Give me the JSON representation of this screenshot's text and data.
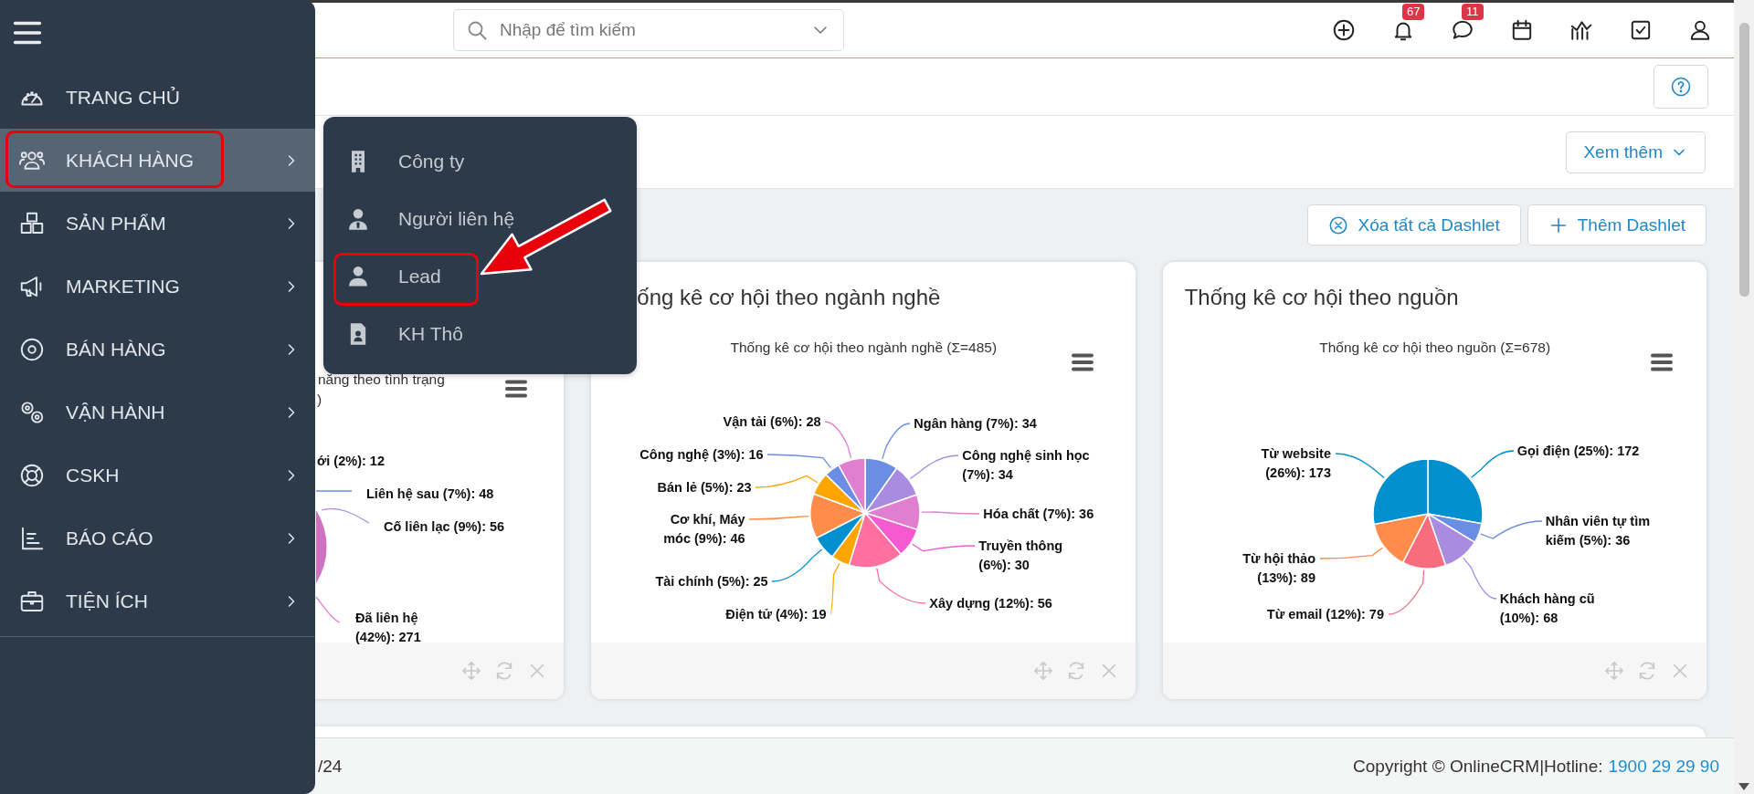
{
  "sidebar": {
    "items": [
      {
        "label": "TRANG CHỦ",
        "selected": false,
        "has_submenu": false
      },
      {
        "label": "KHÁCH HÀNG",
        "selected": true,
        "has_submenu": true
      },
      {
        "label": "SẢN PHẨM",
        "selected": false,
        "has_submenu": true
      },
      {
        "label": "MARKETING",
        "selected": false,
        "has_submenu": true
      },
      {
        "label": "BÁN HÀNG",
        "selected": false,
        "has_submenu": true
      },
      {
        "label": "VẬN HÀNH",
        "selected": false,
        "has_submenu": true
      },
      {
        "label": "CSKH",
        "selected": false,
        "has_submenu": true
      },
      {
        "label": "BÁO CÁO",
        "selected": false,
        "has_submenu": true
      },
      {
        "label": "TIỆN ÍCH",
        "selected": false,
        "has_submenu": true
      }
    ]
  },
  "submenu": {
    "items": [
      {
        "label": "Công ty"
      },
      {
        "label": "Người liên hệ"
      },
      {
        "label": "Lead"
      },
      {
        "label": "KH Thô"
      }
    ]
  },
  "search": {
    "placeholder": "Nhập để tìm kiếm"
  },
  "header": {
    "notification_badge": "67",
    "message_badge": "11"
  },
  "view_more_button": {
    "label": "Xem thêm"
  },
  "dashlet_actions": [
    {
      "label": "Xóa tất cả Dashlet"
    },
    {
      "label": "Thêm Dashlet"
    }
  ],
  "left_dashlet": {
    "chart_title_lines": [
      "năng theo tình trạng",
      ")"
    ],
    "labels": [
      "ới (2%): 12",
      "Liên hệ sau (7%): 48",
      "Cố liên lạc (9%): 56",
      "Đã liên hệ (42%): 271"
    ]
  },
  "dashlets": [
    {
      "title": "ống kê cơ hội theo ngành nghề",
      "chart_data": {
        "type": "pie",
        "title": "Thống kê cơ hội theo ngành nghề (Σ=485)",
        "values": [
          34,
          34,
          36,
          30,
          56,
          19,
          25,
          46,
          23,
          16,
          28
        ],
        "colors": [
          "#6b8de3",
          "#a98be0",
          "#e07fd0",
          "#f55ad0",
          "#ff6fa0",
          "#ffa500",
          "#0090d0",
          "#ff8c4a",
          "#ffa500",
          "#6b8de3",
          "#e07fd0"
        ],
        "value_labels": [
          "Ngân hàng (7%): 34",
          "Công nghệ sinh học (7%): 34",
          "Hóa chất (7%): 36",
          "Truyền thông (6%): 30",
          "Xây dựng (12%): 56",
          "Điện tử (4%): 19",
          "Tài chính (5%): 25",
          "Cơ khí, Máy móc (9%): 46",
          "Bán lẻ (5%): 23",
          "Công nghệ (3%): 16",
          "Vận tải (6%): 28"
        ]
      }
    },
    {
      "title": "Thống kê cơ hội theo nguồn",
      "chart_data": {
        "type": "pie",
        "title": "Thống kê cơ hội theo nguồn (Σ=678)",
        "values": [
          172,
          36,
          68,
          79,
          89,
          173
        ],
        "colors": [
          "#0090d0",
          "#6b8de3",
          "#a98be0",
          "#f86d7e",
          "#ff8c4a",
          "#0090d0"
        ],
        "value_labels": [
          "Gọi điện (25%): 172",
          "Nhân viên tự tìm kiếm (5%): 36",
          "Khách hàng cũ (10%): 68",
          "Từ email (12%): 79",
          "Từ hội thảo (13%): 89",
          "Từ website (26%): 173"
        ]
      }
    }
  ],
  "footer": {
    "left_text": "/24",
    "copyright": "Copyright © OnlineCRM|Hotline:",
    "hotline": "1900 29 29 90"
  }
}
